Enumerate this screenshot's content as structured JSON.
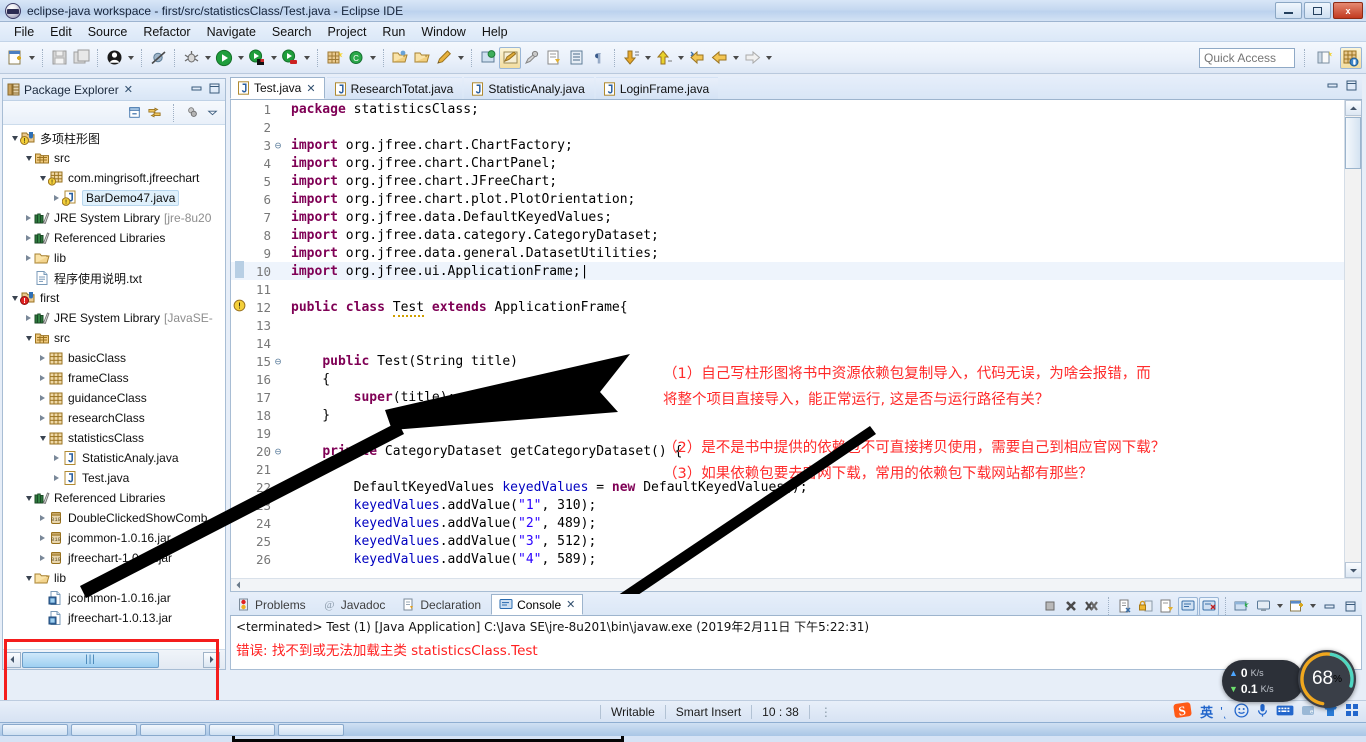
{
  "window": {
    "title": "eclipse-java workspace - first/src/statisticsClass/Test.java - Eclipse IDE",
    "minimize_label": "Minimize",
    "maximize_label": "Restore",
    "close_label": "x"
  },
  "menubar": {
    "items": [
      "File",
      "Edit",
      "Source",
      "Refactor",
      "Navigate",
      "Search",
      "Project",
      "Run",
      "Window",
      "Help"
    ]
  },
  "toolbar": {
    "quick_access_placeholder": "Quick Access",
    "quick_access_value": ""
  },
  "package_explorer": {
    "title": "Package Explorer",
    "close_label": "✕",
    "tree": [
      {
        "indent": 0,
        "arrow": "open",
        "icon": "java-project-warning-icon",
        "label": "多项柱形图",
        "dim": false,
        "selected": false
      },
      {
        "indent": 1,
        "arrow": "open",
        "icon": "source-folder-icon",
        "label": "src",
        "dim": false,
        "selected": false
      },
      {
        "indent": 2,
        "arrow": "open",
        "icon": "package-warning-icon",
        "label": "com.mingrisoft.jfreechart",
        "dim": false,
        "selected": false
      },
      {
        "indent": 3,
        "arrow": "closed",
        "icon": "java-file-warning-icon",
        "label": "BarDemo47.java",
        "dim": false,
        "selected": true
      },
      {
        "indent": 1,
        "arrow": "closed",
        "icon": "library-icon",
        "label": "JRE System Library",
        "suffix": "[jre-8u20",
        "dim": false,
        "selected": false
      },
      {
        "indent": 1,
        "arrow": "closed",
        "icon": "library-icon",
        "label": "Referenced Libraries",
        "dim": false,
        "selected": false
      },
      {
        "indent": 1,
        "arrow": "closed",
        "icon": "folder-icon",
        "label": "lib",
        "dim": false,
        "selected": false
      },
      {
        "indent": 1,
        "arrow": "none",
        "icon": "text-file-icon",
        "label": "程序使用说明.txt",
        "dim": false,
        "selected": false
      },
      {
        "indent": 0,
        "arrow": "open",
        "icon": "java-project-error-icon",
        "label": "first",
        "dim": false,
        "selected": false
      },
      {
        "indent": 1,
        "arrow": "closed",
        "icon": "library-icon",
        "label": "JRE System Library",
        "suffix": "[JavaSE-",
        "dim": false,
        "selected": false
      },
      {
        "indent": 1,
        "arrow": "open",
        "icon": "source-folder-icon",
        "label": "src",
        "dim": false,
        "selected": false
      },
      {
        "indent": 2,
        "arrow": "closed",
        "icon": "package-icon",
        "label": "basicClass",
        "dim": false,
        "selected": false
      },
      {
        "indent": 2,
        "arrow": "closed",
        "icon": "package-icon",
        "label": "frameClass",
        "dim": false,
        "selected": false
      },
      {
        "indent": 2,
        "arrow": "closed",
        "icon": "package-icon",
        "label": "guidanceClass",
        "dim": false,
        "selected": false
      },
      {
        "indent": 2,
        "arrow": "closed",
        "icon": "package-icon",
        "label": "researchClass",
        "dim": false,
        "selected": false
      },
      {
        "indent": 2,
        "arrow": "open",
        "icon": "package-icon",
        "label": "statisticsClass",
        "dim": false,
        "selected": false
      },
      {
        "indent": 3,
        "arrow": "closed",
        "icon": "java-file-icon",
        "label": "StatisticAnaly.java",
        "dim": false,
        "selected": false
      },
      {
        "indent": 3,
        "arrow": "closed",
        "icon": "java-file-icon",
        "label": "Test.java",
        "dim": false,
        "selected": false
      },
      {
        "indent": 1,
        "arrow": "open",
        "icon": "library-icon",
        "label": "Referenced Libraries",
        "dim": false,
        "selected": false
      },
      {
        "indent": 2,
        "arrow": "closed",
        "icon": "jar-icon",
        "label": "DoubleClickedShowComb",
        "dim": false,
        "selected": false
      },
      {
        "indent": 2,
        "arrow": "closed",
        "icon": "jar-icon",
        "label": "jcommon-1.0.16.jar",
        "dim": false,
        "selected": false
      },
      {
        "indent": 2,
        "arrow": "closed",
        "icon": "jar-icon",
        "label": "jfreechart-1.0.13.jar",
        "dim": false,
        "selected": false
      },
      {
        "indent": 1,
        "arrow": "open",
        "icon": "folder-icon",
        "label": "lib",
        "dim": false,
        "selected": false
      },
      {
        "indent": 2,
        "arrow": "none",
        "icon": "jar-file-icon",
        "label": "jcommon-1.0.16.jar",
        "dim": false,
        "selected": false
      },
      {
        "indent": 2,
        "arrow": "none",
        "icon": "jar-file-icon",
        "label": "jfreechart-1.0.13.jar",
        "dim": false,
        "selected": false
      }
    ]
  },
  "editor": {
    "tabs": [
      {
        "label": "LoginFrame.java",
        "active": false,
        "closable": false
      },
      {
        "label": "StatisticAnaly.java",
        "active": false,
        "closable": false
      },
      {
        "label": "ResearchTotat.java",
        "active": false,
        "closable": false
      },
      {
        "label": "Test.java",
        "active": true,
        "closable": true
      }
    ],
    "close_glyph": "✕",
    "code_lines": [
      {
        "n": "1",
        "fold": "",
        "mark": "",
        "html": "<span class=\"kw\">package</span> statisticsClass;"
      },
      {
        "n": "2",
        "fold": "",
        "mark": "",
        "html": ""
      },
      {
        "n": "3",
        "fold": "⊖",
        "mark": "",
        "html": "<span class=\"kw\">import</span> org.jfree.chart.ChartFactory;"
      },
      {
        "n": "4",
        "fold": "",
        "mark": "",
        "html": "<span class=\"kw\">import</span> org.jfree.chart.ChartPanel;"
      },
      {
        "n": "5",
        "fold": "",
        "mark": "",
        "html": "<span class=\"kw\">import</span> org.jfree.chart.JFreeChart;"
      },
      {
        "n": "6",
        "fold": "",
        "mark": "",
        "html": "<span class=\"kw\">import</span> org.jfree.chart.plot.PlotOrientation;"
      },
      {
        "n": "7",
        "fold": "",
        "mark": "",
        "html": "<span class=\"kw\">import</span> org.jfree.data.DefaultKeyedValues;"
      },
      {
        "n": "8",
        "fold": "",
        "mark": "",
        "html": "<span class=\"kw\">import</span> org.jfree.data.category.CategoryDataset;"
      },
      {
        "n": "9",
        "fold": "",
        "mark": "",
        "html": "<span class=\"kw\">import</span> org.jfree.data.general.DatasetUtilities;"
      },
      {
        "n": "10",
        "fold": "",
        "mark": "▨",
        "hl": true,
        "html": "<span class=\"kw\">import</span> org.jfree.ui.ApplicationFrame;<span class=\"caret\">|</span>"
      },
      {
        "n": "11",
        "fold": "",
        "mark": "",
        "html": ""
      },
      {
        "n": "12",
        "fold": "",
        "mark": "⚠",
        "html": "<span class=\"kw\">public</span> <span class=\"kw\">class</span> <span class=\"warnline\">Test</span> <span class=\"kw\">extends</span> ApplicationFrame{"
      },
      {
        "n": "13",
        "fold": "",
        "mark": "",
        "html": ""
      },
      {
        "n": "14",
        "fold": "",
        "mark": "",
        "html": ""
      },
      {
        "n": "15",
        "fold": "⊖",
        "mark": "",
        "html": "    <span class=\"kw\">public</span> Test(String title)"
      },
      {
        "n": "16",
        "fold": "",
        "mark": "",
        "html": "    {"
      },
      {
        "n": "17",
        "fold": "",
        "mark": "",
        "html": "        <span class=\"kw\">super</span>(title);"
      },
      {
        "n": "18",
        "fold": "",
        "mark": "",
        "html": "    }"
      },
      {
        "n": "19",
        "fold": "",
        "mark": "",
        "html": ""
      },
      {
        "n": "20",
        "fold": "⊖",
        "mark": "",
        "html": "    <span class=\"kw\">private</span> CategoryDataset getCategoryDataset() {"
      },
      {
        "n": "21",
        "fold": "",
        "mark": "",
        "html": ""
      },
      {
        "n": "22",
        "fold": "",
        "mark": "",
        "html": "        DefaultKeyedValues <span class=\"fld\">keyedValues</span> = <span class=\"kw\">new</span> DefaultKeyedValues();"
      },
      {
        "n": "23",
        "fold": "",
        "mark": "",
        "html": "        <span class=\"fld\">keyedValues</span>.addValue(<span class=\"str\">\"1\"</span>, 310);"
      },
      {
        "n": "24",
        "fold": "",
        "mark": "",
        "html": "        <span class=\"fld\">keyedValues</span>.addValue(<span class=\"str\">\"2\"</span>, 489);"
      },
      {
        "n": "25",
        "fold": "",
        "mark": "",
        "html": "        <span class=\"fld\">keyedValues</span>.addValue(<span class=\"str\">\"3\"</span>, 512);"
      },
      {
        "n": "26",
        "fold": "",
        "mark": "",
        "html": "        <span class=\"fld\">keyedValues</span>.addValue(<span class=\"str\">\"4\"</span>, 589);"
      }
    ]
  },
  "annotations": {
    "color": "#ff2b2b",
    "lines": [
      "（1）自己写柱形图将书中资源依赖包复制导入，代码无误，为啥会报错，而",
      "将整个项目直接导入，能正常运行, 这是否与运行路径有关？",
      "",
      "（2）是不是书中提供的依赖包不可直接拷贝使用，需要自己到相应官网下载？",
      "（3）如果依赖包要去官网下载，常用的依赖包下载网站都有那些？"
    ]
  },
  "console": {
    "tabs": [
      {
        "label": "Problems",
        "icon": "problems-icon",
        "active": false
      },
      {
        "label": "Javadoc",
        "icon": "javadoc-icon",
        "active": false
      },
      {
        "label": "Declaration",
        "icon": "declaration-icon",
        "active": false
      },
      {
        "label": "Console",
        "icon": "console-icon",
        "active": true
      }
    ],
    "close_glyph": "✕",
    "line1": "<terminated> Test (1) [Java Application] C:\\Java SE\\jre-8u201\\bin\\javaw.exe (2019年2月11日 下午5:22:31)",
    "line2": "错误: 找不到或无法加载主类 statisticsClass.Test"
  },
  "statusbar": {
    "writable": "Writable",
    "insert_mode": "Smart Insert",
    "position": "10 : 38"
  },
  "tray": {
    "ime_label": "英",
    "net_up": "0",
    "net_up_unit": "K/s",
    "net_down": "0.1",
    "net_down_unit": "K/s",
    "cpu_percent": "68",
    "cpu_unit": "%"
  }
}
